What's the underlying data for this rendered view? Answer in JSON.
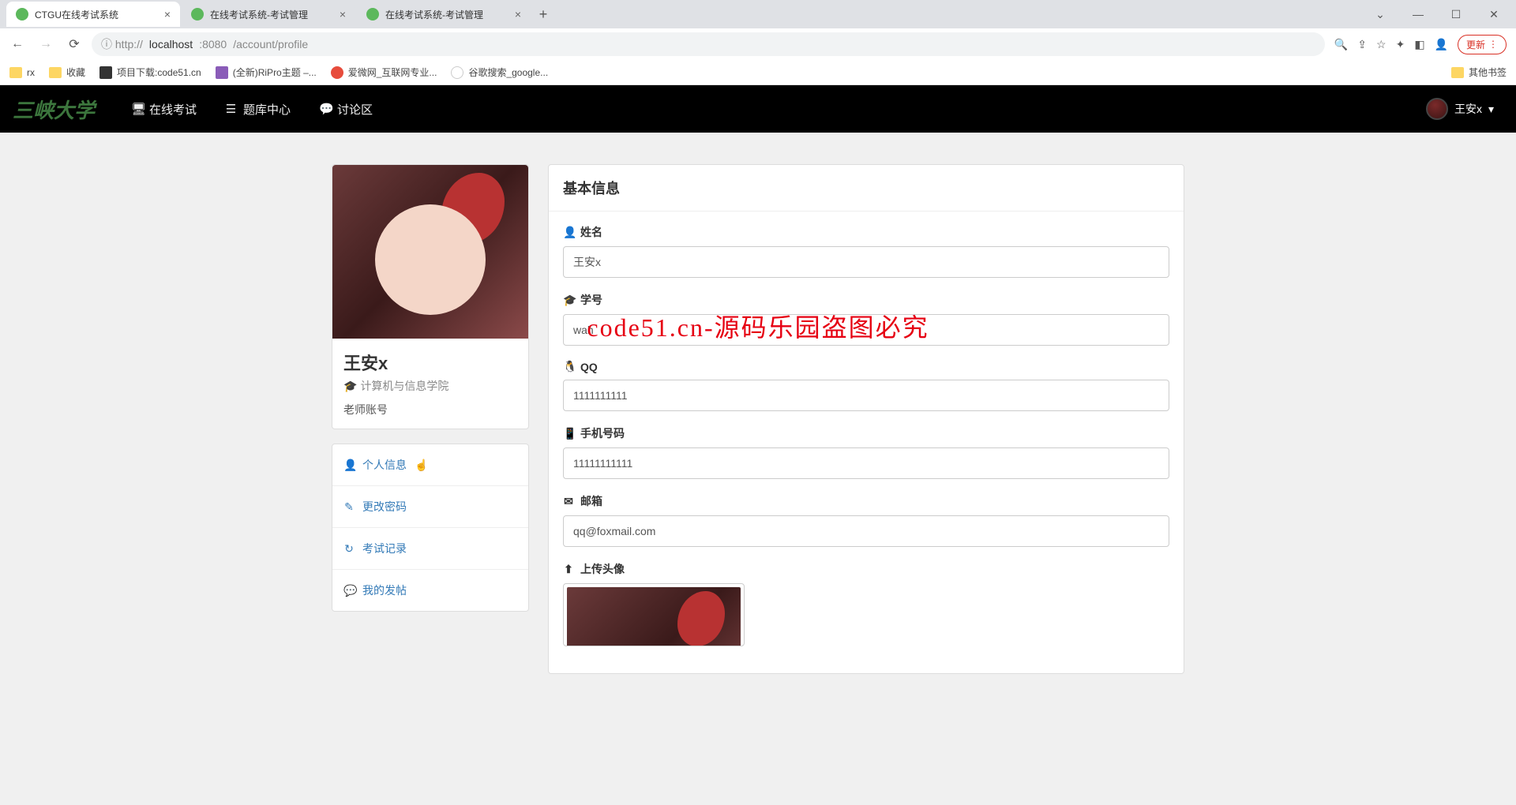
{
  "browser": {
    "tabs": [
      {
        "title": "CTGU在线考试系统"
      },
      {
        "title": "在线考试系统-考试管理"
      },
      {
        "title": "在线考试系统-考试管理"
      }
    ],
    "url_scheme": "ⓘ http://",
    "url_host": "localhost",
    "url_port": ":8080",
    "url_path": "/account/profile",
    "update_btn": "更新",
    "bookmarks": [
      {
        "label": "rx"
      },
      {
        "label": "收藏"
      },
      {
        "label": "项目下载:code51.cn"
      },
      {
        "label": "(全新)RiPro主题 –..."
      },
      {
        "label": "爱微网_互联网专业..."
      },
      {
        "label": "谷歌搜索_google..."
      }
    ],
    "other_bookmarks": "其他书签"
  },
  "nav": {
    "brand": "三峡大学",
    "items": [
      {
        "icon": "🖥",
        "label": "在线考试"
      },
      {
        "icon": "☰",
        "label": "题库中心"
      },
      {
        "icon": "💬",
        "label": "讨论区"
      }
    ],
    "user": "王安x"
  },
  "profile": {
    "name": "王安x",
    "dept": "计算机与信息学院",
    "role": "老师账号"
  },
  "menu": [
    {
      "icon": "👤",
      "label": "个人信息"
    },
    {
      "icon": "✎",
      "label": "更改密码"
    },
    {
      "icon": "↻",
      "label": "考试记录"
    },
    {
      "icon": "💬",
      "label": "我的发帖"
    }
  ],
  "form": {
    "title": "基本信息",
    "fields": {
      "name": {
        "icon": "👤",
        "label": "姓名",
        "value": "王安x"
      },
      "stuid": {
        "icon": "🎓",
        "label": "学号",
        "value": "wah"
      },
      "qq": {
        "icon": "🐧",
        "label": "QQ",
        "value": "1111111111"
      },
      "phone": {
        "icon": "📱",
        "label": "手机号码",
        "value": "11111111111"
      },
      "email": {
        "icon": "✉",
        "label": "邮箱",
        "value": "qq@foxmail.com"
      },
      "avatar": {
        "icon": "⬆",
        "label": "上传头像"
      }
    }
  },
  "watermark": "code51.cn-源码乐园盗图必究"
}
